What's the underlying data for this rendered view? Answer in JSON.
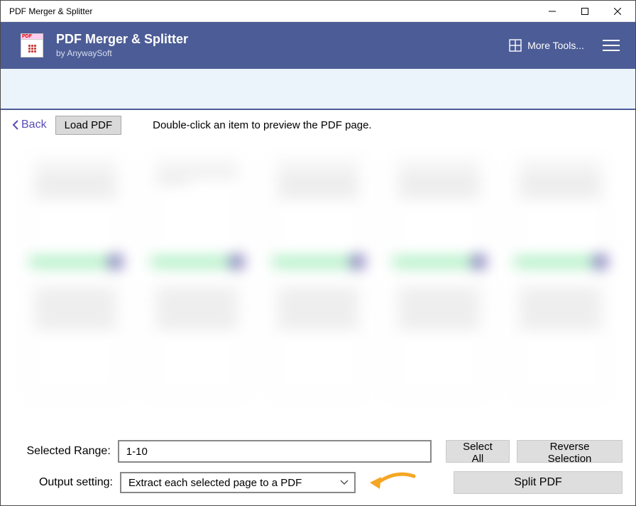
{
  "window": {
    "title": "PDF Merger & Splitter"
  },
  "header": {
    "app_title": "PDF Merger & Splitter",
    "app_subtitle": "by AnywaySoft",
    "more_tools_label": "More Tools..."
  },
  "toolbar": {
    "back_label": "Back",
    "load_pdf_label": "Load PDF",
    "hint_text": "Double-click an item to preview the PDF page."
  },
  "controls": {
    "selected_range_label": "Selected Range:",
    "selected_range_value": "1-10",
    "select_all_label": "Select All",
    "reverse_selection_label": "Reverse Selection",
    "output_setting_label": "Output setting:",
    "output_setting_value": "Extract each selected page to a PDF",
    "split_pdf_label": "Split PDF"
  },
  "colors": {
    "header_bg": "#4c5c96",
    "accent_link": "#5a4db3",
    "button_bg": "#dedede",
    "annotation_arrow": "#f5a623"
  }
}
